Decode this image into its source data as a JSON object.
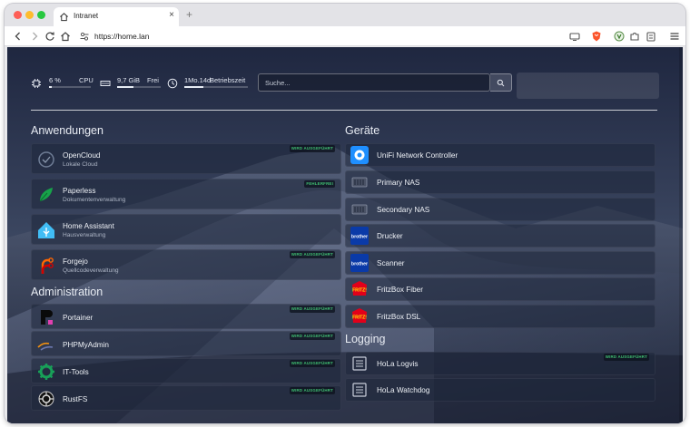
{
  "browser": {
    "tab_title": "Intranet",
    "tab_close": "×",
    "new_tab": "+",
    "url": "https://home.lan"
  },
  "stats": {
    "cpu_value": "6 %",
    "cpu_label": "CPU",
    "cpu_usage": 0.06,
    "ram_value": "9,7 GiB",
    "ram_label": "Frei",
    "ram_usage": 0.38,
    "uptime_value": "1Mo.14d",
    "uptime_label": "Betriebszeit",
    "uptime_bar": 0.3
  },
  "search": {
    "placeholder": "Suche..."
  },
  "sections": {
    "apps": "Anwendungen",
    "admin": "Administration",
    "devices": "Geräte",
    "logging": "Logging"
  },
  "apps": [
    {
      "name": "OpenCloud",
      "desc": "Lokale Cloud",
      "badge": "WIRD AUSGEFÜHRT",
      "icon": "opencloud-icon"
    },
    {
      "name": "Paperless",
      "desc": "Dokumentenverwaltung",
      "badge": "FEHLERFREI",
      "icon": "paperless-icon"
    },
    {
      "name": "Home Assistant",
      "desc": "Hausverwaltung",
      "badge": "",
      "icon": "home-assistant-icon"
    },
    {
      "name": "Forgejo",
      "desc": "Quellcodeverwaltung",
      "badge": "WIRD AUSGEFÜHRT",
      "icon": "forgejo-icon"
    }
  ],
  "admin": [
    {
      "name": "Portainer",
      "badge": "WIRD AUSGEFÜHRT",
      "icon": "portainer-icon"
    },
    {
      "name": "PHPMyAdmin",
      "badge": "WIRD AUSGEFÜHRT",
      "icon": "phpmyadmin-icon"
    },
    {
      "name": "IT-Tools",
      "badge": "WIRD AUSGEFÜHRT",
      "icon": "it-tools-icon"
    },
    {
      "name": "RustFS",
      "badge": "WIRD AUSGEFÜHRT",
      "icon": "rustfs-icon"
    }
  ],
  "devices": [
    {
      "name": "UniFi Network Controller",
      "icon": "unifi-icon"
    },
    {
      "name": "Primary NAS",
      "icon": "nas-icon"
    },
    {
      "name": "Secondary NAS",
      "icon": "nas-icon"
    },
    {
      "name": "Drucker",
      "icon": "brother-icon",
      "logo_text": "brother"
    },
    {
      "name": "Scanner",
      "icon": "brother-icon",
      "logo_text": "brother"
    },
    {
      "name": "FritzBox Fiber",
      "icon": "fritz-icon",
      "logo_text": "FRITZ!"
    },
    {
      "name": "FritzBox DSL",
      "icon": "fritz-icon",
      "logo_text": "FRITZ!"
    }
  ],
  "logging": [
    {
      "name": "HoLa Logvis",
      "badge": "WIRD AUSGEFÜHRT",
      "icon": "log-icon"
    },
    {
      "name": "HoLa Watchdog",
      "badge": "",
      "icon": "log-icon"
    }
  ],
  "colors": {
    "badge_green": "#3fbf72",
    "background": "#2a3247",
    "unifi_blue": "#1f8fff",
    "brother_blue": "#0a3aa8",
    "fritz_red": "#e2001a"
  }
}
